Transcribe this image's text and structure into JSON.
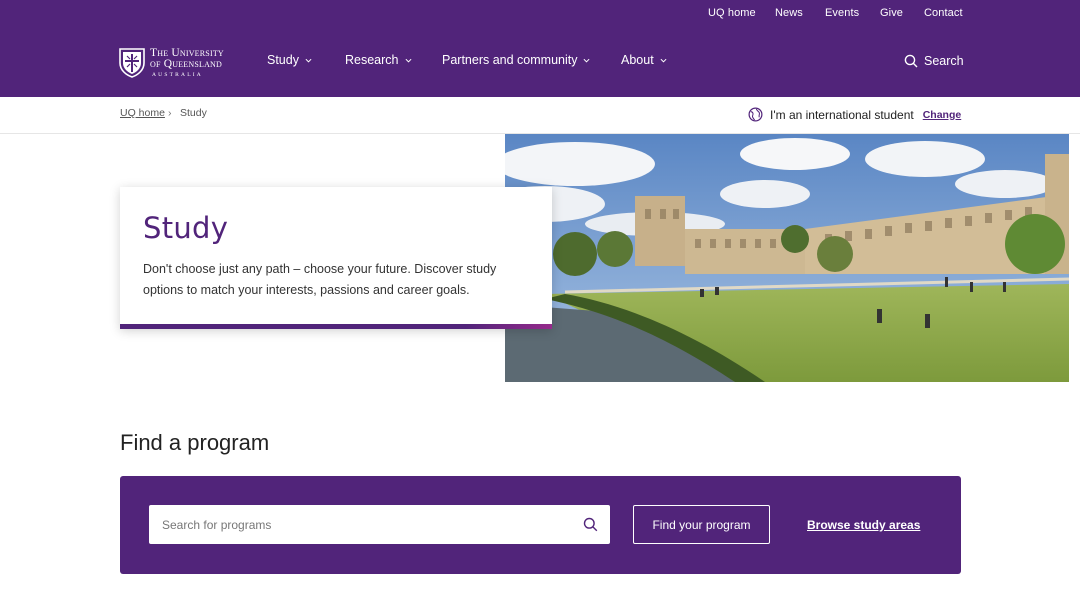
{
  "utility_links": [
    "UQ home",
    "News",
    "Events",
    "Give",
    "Contact"
  ],
  "logo": {
    "line1": "The University",
    "line2": "of Queensland",
    "line3": "AUSTRALIA"
  },
  "nav": {
    "items": [
      "Study",
      "Research",
      "Partners and community",
      "About"
    ],
    "search_label": "Search"
  },
  "breadcrumb": {
    "home": "UQ home",
    "separator": "›",
    "current": "Study"
  },
  "international": {
    "label": "I'm an international student",
    "change": "Change"
  },
  "hero": {
    "title": "Study",
    "description": "Don't choose just any path – choose your future. Discover study options to match your interests, passions and career goals."
  },
  "find_program": {
    "title": "Find a program",
    "search_placeholder": "Search for programs",
    "button": "Find your program",
    "browse": "Browse study areas"
  },
  "colors": {
    "brand_purple": "#51247a",
    "accent_magenta": "#962a8b"
  },
  "icons": {
    "search": "search-icon",
    "globe": "globe-icon",
    "chevron": "chevron-down-icon",
    "crest": "uq-crest-logo"
  }
}
